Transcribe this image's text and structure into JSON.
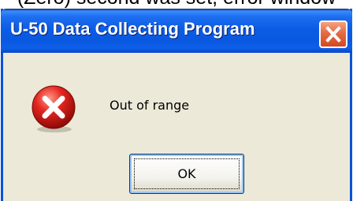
{
  "caption": "(Zero) second was set, error window",
  "dialog": {
    "title": "U-50 Data Collecting Program",
    "message": "Out of range",
    "ok_label": "OK",
    "icons": {
      "status": "error-icon",
      "close": "close-icon"
    }
  },
  "colors": {
    "titlebar_blue": "#0b5ce5",
    "frame_blue": "#0a52d6",
    "dialog_face": "#ece9d8",
    "close_red": "#e46a45",
    "error_red": "#d81a1a"
  }
}
